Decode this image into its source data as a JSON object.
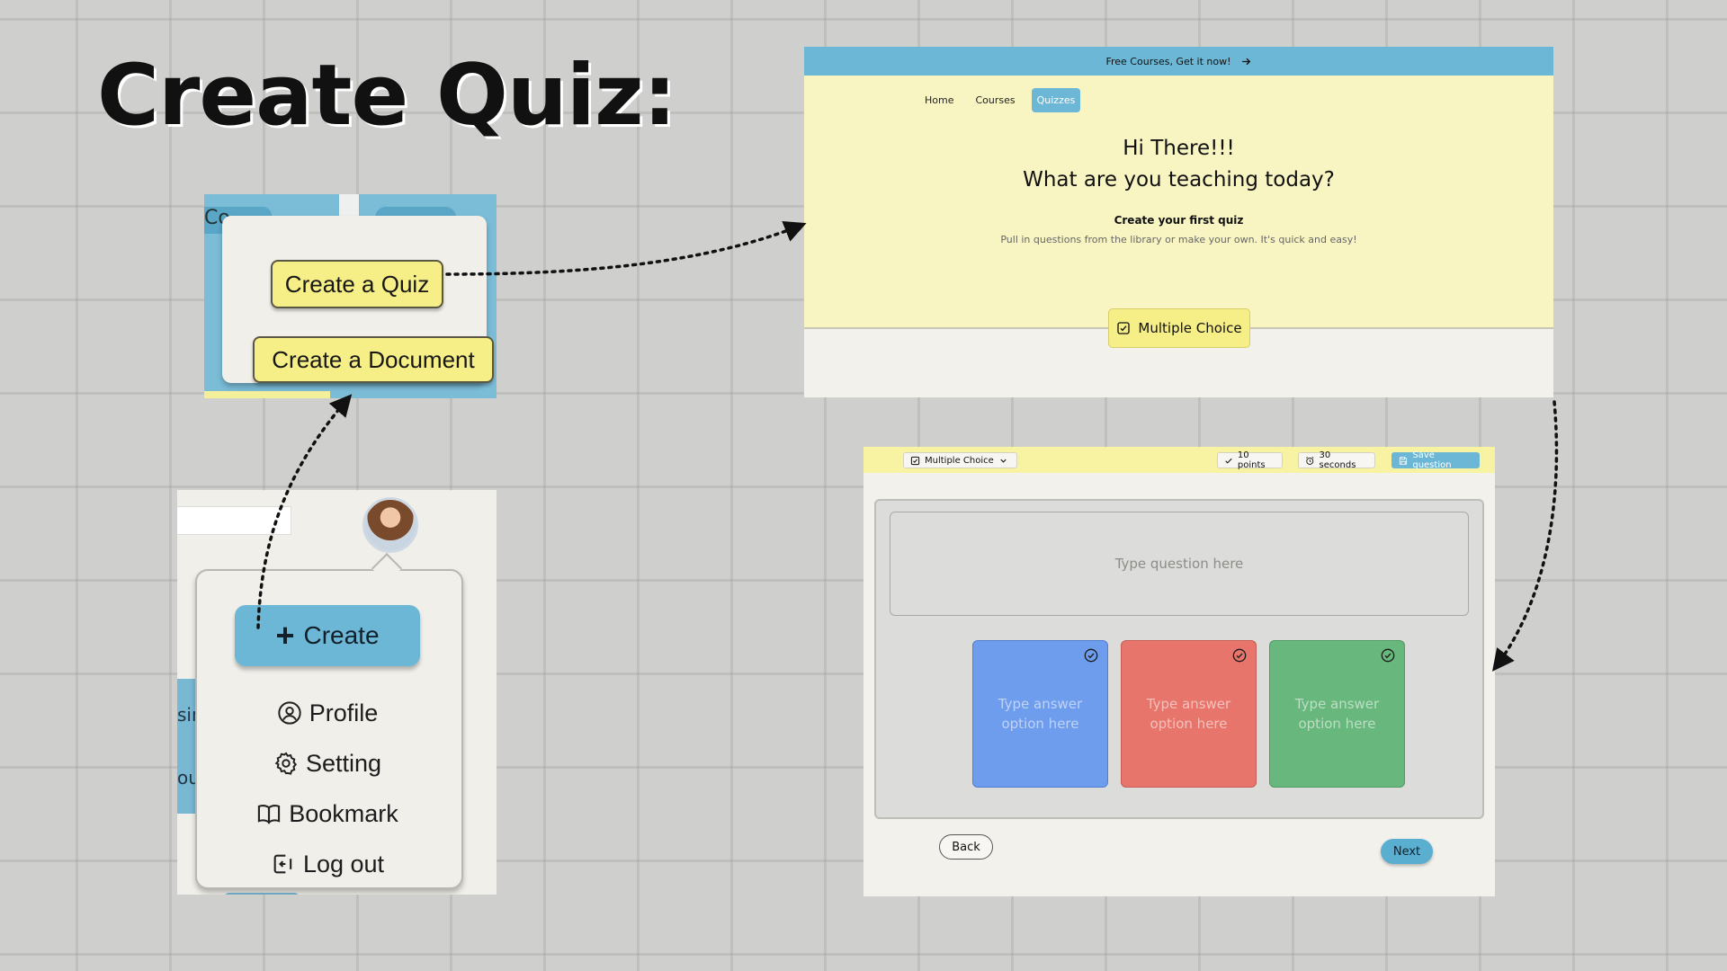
{
  "slide": {
    "title": "Create Quiz:"
  },
  "create_menu": {
    "side_text_1": "sin",
    "side_text_2": "our",
    "create_label": "Create",
    "items": [
      {
        "label": "Profile",
        "icon": "profile-icon"
      },
      {
        "label": "Setting",
        "icon": "gear-icon"
      },
      {
        "label": "Bookmark",
        "icon": "book-icon"
      },
      {
        "label": "Log out",
        "icon": "logout-icon"
      }
    ]
  },
  "quiz_popover": {
    "tab_text": "Co",
    "create_quiz_label": "Create a Quiz",
    "create_document_label": "Create a Document"
  },
  "home_page": {
    "banner_text": "Free Courses, Get it now!",
    "nav": [
      "Home",
      "Courses",
      "Quizzes"
    ],
    "active_nav": "Quizzes",
    "greeting_line1": "Hi There!!!",
    "greeting_line2": "What are you teaching today?",
    "subtitle": "Create your first quiz",
    "subtext": "Pull in questions from the library or make your own. It's quick and easy!",
    "multiple_choice_label": "Multiple Choice"
  },
  "editor": {
    "question_type": "Multiple Choice",
    "points": "10 points",
    "time": "30 seconds",
    "save_label": "Save question",
    "question_placeholder": "Type question here",
    "answers": [
      {
        "placeholder": "Type answer option here",
        "color": "#6f9ded"
      },
      {
        "placeholder": "Type answer option here",
        "color": "#e7756b"
      },
      {
        "placeholder": "Type answer option here",
        "color": "#68b77c"
      }
    ],
    "back_label": "Back",
    "next_label": "Next"
  },
  "colors": {
    "accent_blue": "#6cb7d5",
    "accent_yellow": "#f6ee86",
    "hero_yellow": "#f8f5c2"
  }
}
